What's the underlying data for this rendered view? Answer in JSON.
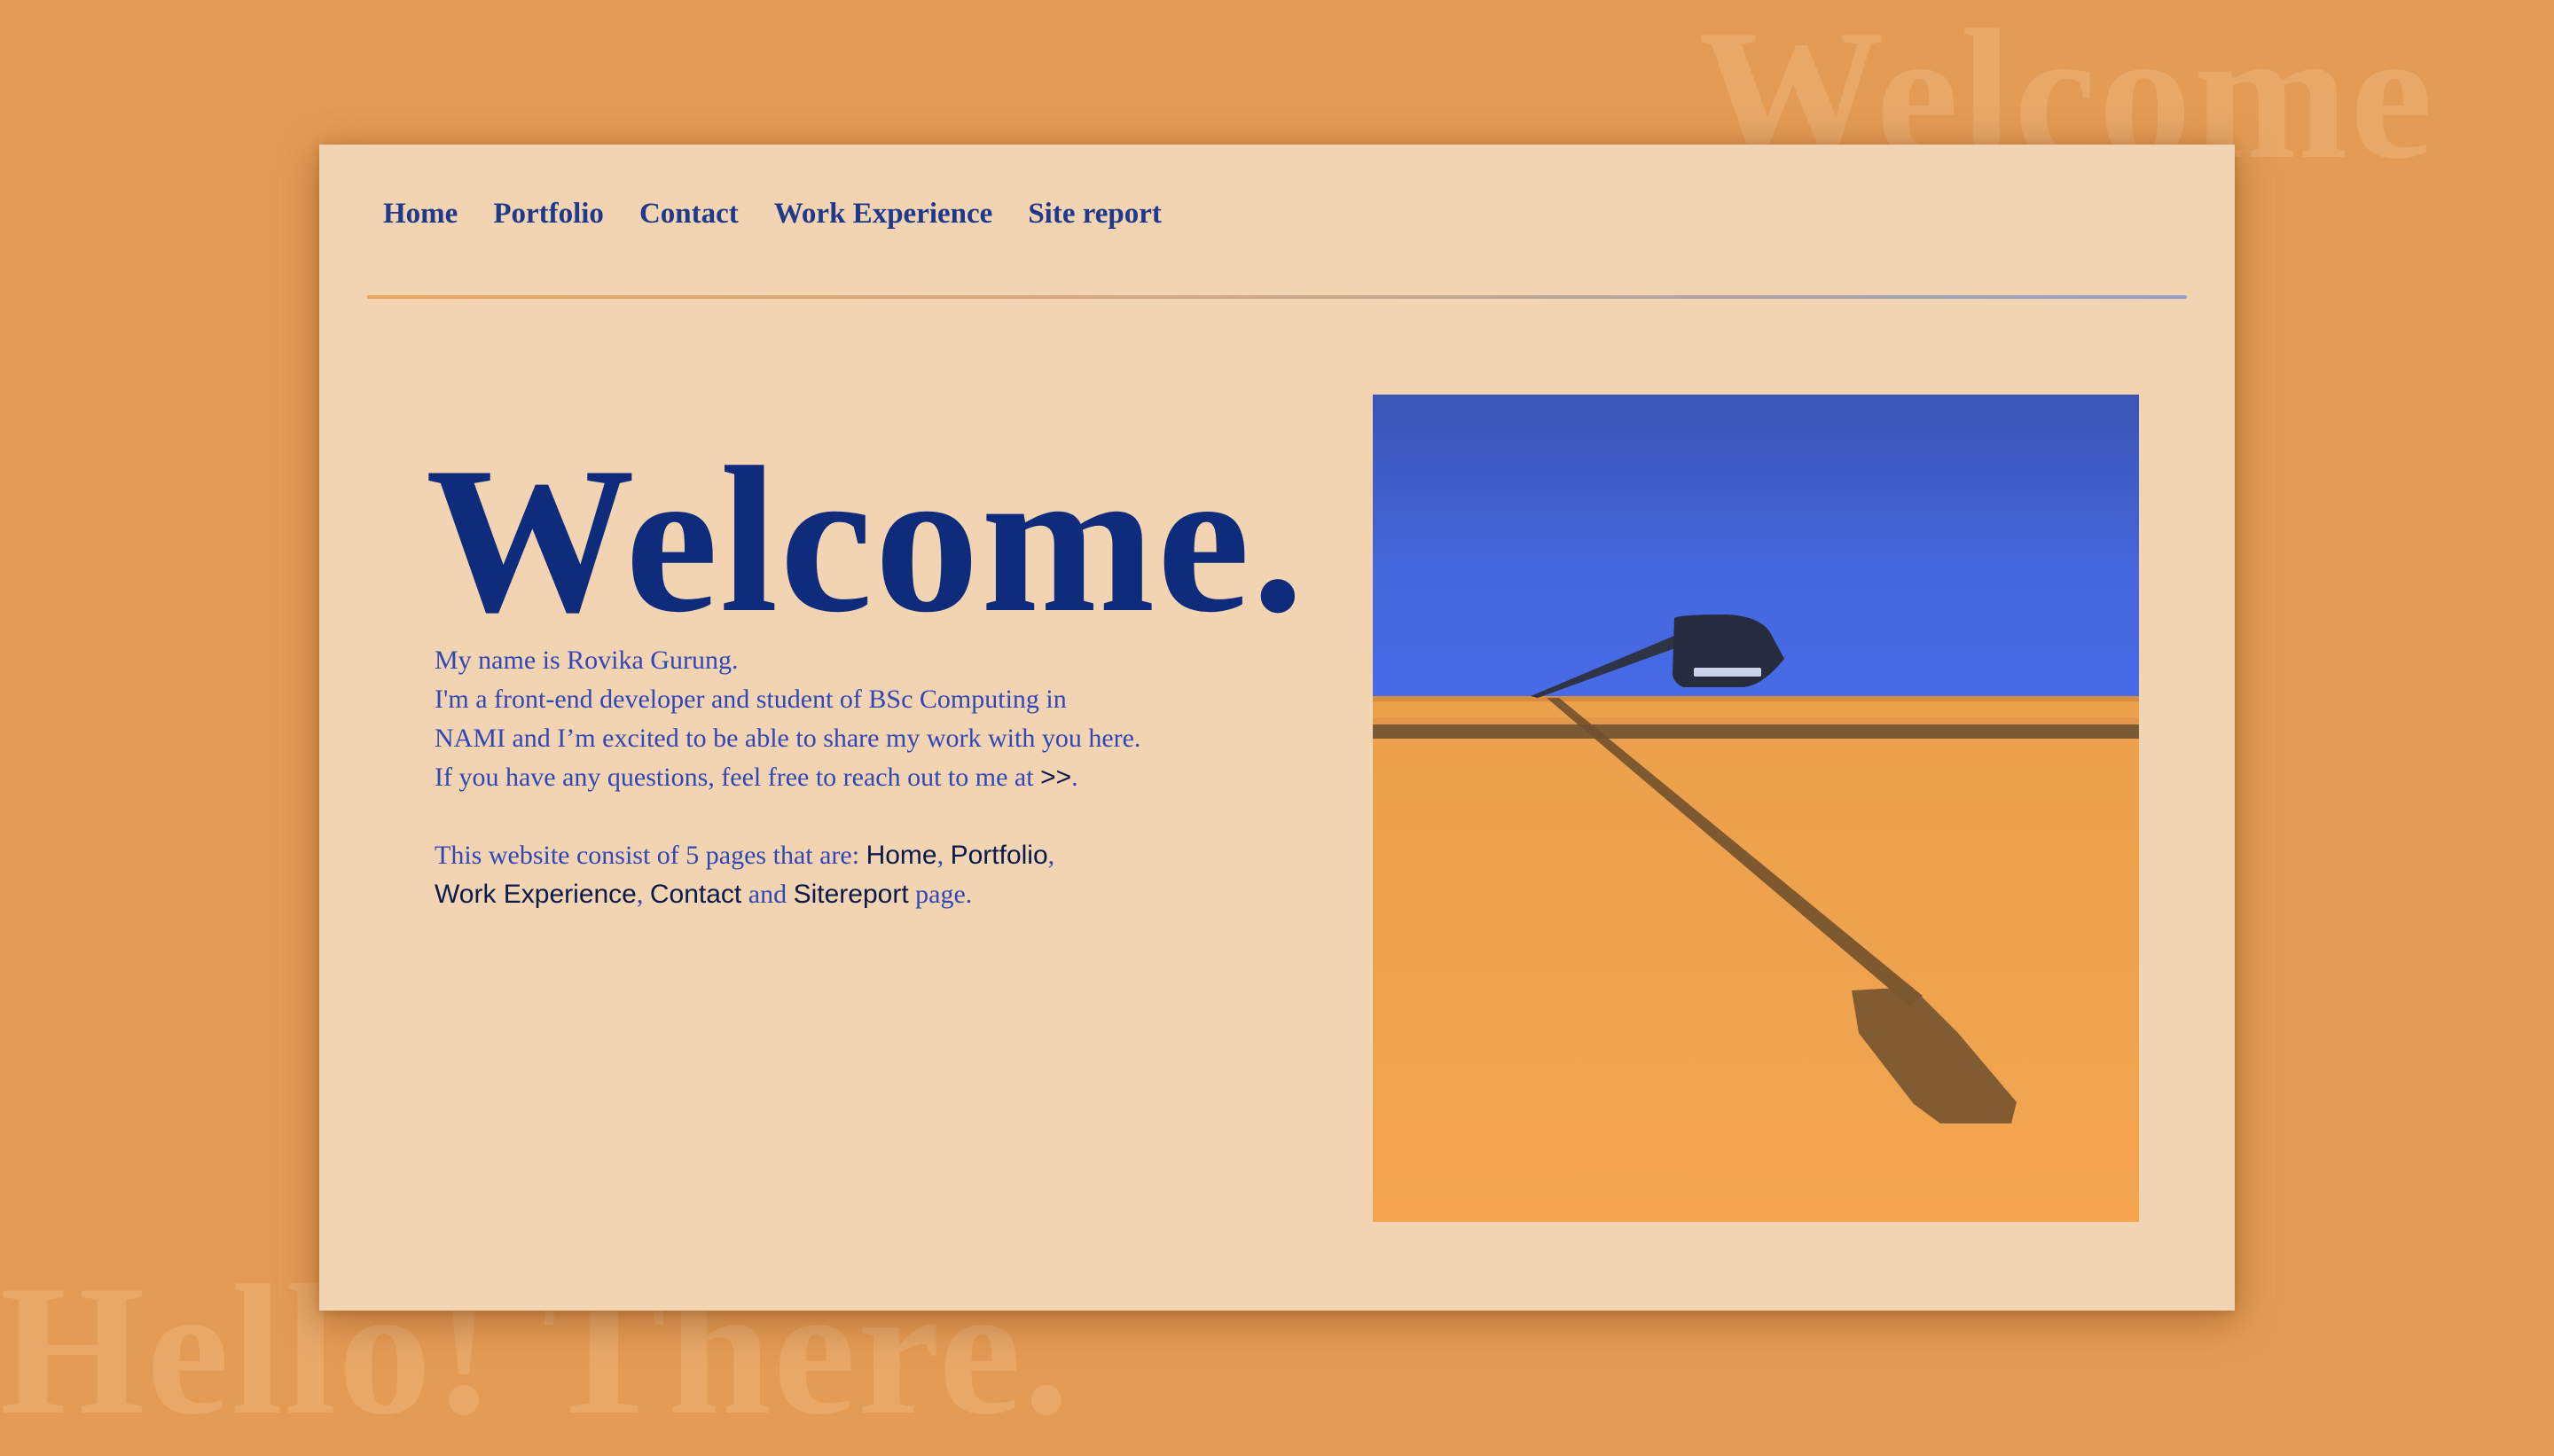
{
  "background": {
    "color": "#E39C56",
    "top_word": "Welcome",
    "bottom_word": "Hello! There."
  },
  "nav": {
    "items": [
      {
        "label": "Home"
      },
      {
        "label": "Portfolio"
      },
      {
        "label": "Contact"
      },
      {
        "label": "Work Experience"
      },
      {
        "label": "Site report"
      }
    ]
  },
  "hero": {
    "title": "Welcome.",
    "line1": "My name is Rovika Gurung.",
    "line2_before": "I'm a front-end developer and student of BSc Computing in NAMI and I’m excited to be able to share my work with you here. If you have any questions, feel free to reach out to me at ",
    "line2_arrows": ">>",
    "line2_after": ".",
    "pages_intro": "This website consist of 5 pages that are: ",
    "links": {
      "home": "Home",
      "portfolio": "Portfolio",
      "work_experience": "Work Experience",
      "contact": "Contact",
      "sitereport": "Sitereport"
    },
    "sep_comma1": ", ",
    "sep_comma2": ",",
    "sep_comma3": ", ",
    "sep_and": " and ",
    "pages_outro": " page."
  },
  "image": {
    "subject": "street lamp shadow on orange wall"
  },
  "colors": {
    "card": "#F2D3B2",
    "nav_text": "#1F3A8A",
    "title": "#0E2B7C",
    "body_text": "#2F47B8",
    "link_text": "#0A1A4A",
    "sky": "#4567DD",
    "wall": "#F0A44E"
  }
}
